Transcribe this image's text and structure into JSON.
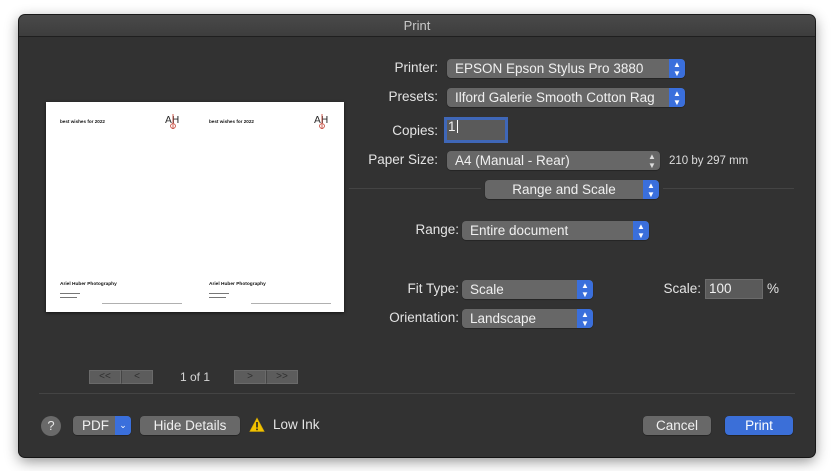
{
  "window": {
    "title": "Print"
  },
  "preview": {
    "pages": [
      {
        "heading": "best wishes for 2022",
        "name": "Ariel Huber Photography"
      },
      {
        "heading": "best wishes for 2022",
        "name": "Ariel Huber Photography"
      }
    ],
    "logo_text": "AH"
  },
  "navigation": {
    "first_label": "<<",
    "prev_label": "<",
    "next_label": ">",
    "last_label": ">>",
    "page_count": "1 of 1"
  },
  "settings": {
    "printer": {
      "label": "Printer:",
      "value": "EPSON Epson Stylus Pro 3880"
    },
    "presets": {
      "label": "Presets:",
      "value": "Ilford Galerie Smooth Cotton Rag"
    },
    "copies": {
      "label": "Copies:",
      "value": "1"
    },
    "paper_size": {
      "label": "Paper Size:",
      "value": "A4 (Manual - Rear)",
      "dimensions": "210 by 297 mm"
    },
    "section": {
      "value": "Range and Scale"
    },
    "range": {
      "label": "Range:",
      "value": "Entire document"
    },
    "fit_type": {
      "label": "Fit Type:",
      "value": "Scale"
    },
    "scale": {
      "label": "Scale:",
      "value": "100",
      "unit": "%"
    },
    "orientation": {
      "label": "Orientation:",
      "value": "Landscape"
    }
  },
  "footer": {
    "help_label": "?",
    "pdf_label": "PDF",
    "hide_details_label": "Hide Details",
    "low_ink_label": "Low Ink",
    "cancel_label": "Cancel",
    "print_label": "Print"
  },
  "colors": {
    "window_bg": "#323232",
    "accent": "#3b6fd8",
    "warning": "#f2c200"
  }
}
